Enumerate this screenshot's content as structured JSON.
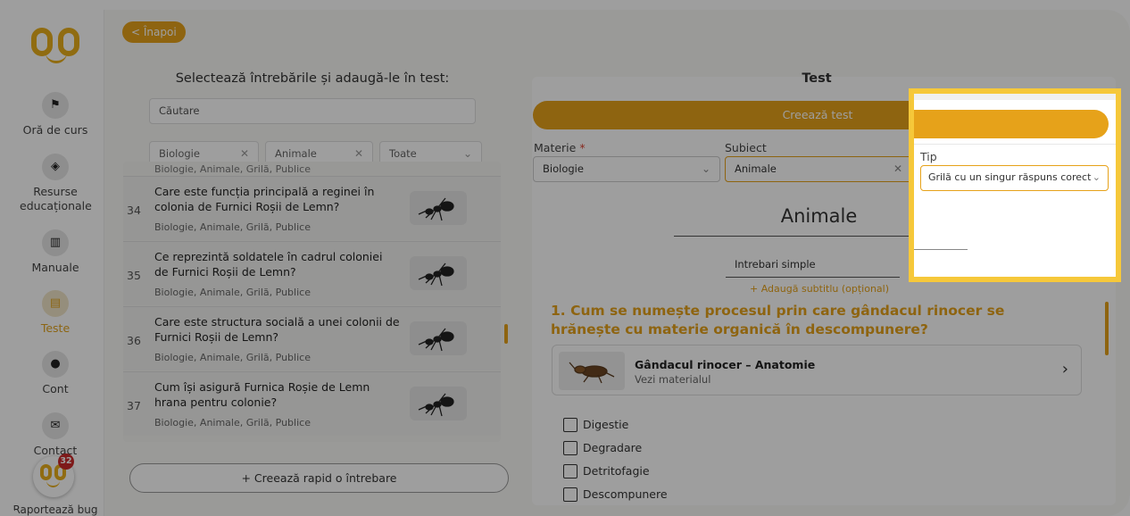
{
  "sidebar": {
    "items": [
      {
        "label": "Oră de curs",
        "icon": "presentation-icon",
        "glyph": "⚑"
      },
      {
        "label": "Resurse educaționale",
        "icon": "cube-icon",
        "glyph": "◈"
      },
      {
        "label": "Manuale",
        "icon": "book-icon",
        "glyph": "▥"
      },
      {
        "label": "Teste",
        "icon": "document-icon",
        "glyph": "▤"
      },
      {
        "label": "Cont",
        "icon": "user-icon",
        "glyph": "●"
      },
      {
        "label": "Contact",
        "icon": "mail-icon",
        "glyph": "✉"
      }
    ],
    "badge": "32",
    "bug_label": "Raportează bug"
  },
  "left": {
    "back_label": "< Înapoi",
    "title": "Selectează întrebările și adaugă-le în test:",
    "search_placeholder": "Căutare",
    "filters": [
      "Biologie",
      "Animale",
      "Toate"
    ],
    "partial_tags": "Biologie, Animale, Grilă, Publice",
    "questions": [
      {
        "num": "34",
        "text": "Care este funcția principală a reginei în colonia de Furnici Roșii de Lemn?",
        "tags": "Biologie, Animale, Grilă, Publice"
      },
      {
        "num": "35",
        "text": "Ce reprezintă soldatele în cadrul coloniei de Furnici Roșii de Lemn?",
        "tags": "Biologie, Animale, Grilă, Publice"
      },
      {
        "num": "36",
        "text": "Care este structura socială a unei colonii de Furnici Roșii de Lemn?",
        "tags": "Biologie, Animale, Grilă, Publice"
      },
      {
        "num": "37",
        "text": "Cum își asigură Furnica Roșie de Lemn hrana pentru colonie?",
        "tags": "Biologie, Animale, Grilă, Publice"
      }
    ],
    "quick_create": "+ Creează rapid o întrebare"
  },
  "right": {
    "title": "Test",
    "create_button": "Creează test",
    "materie_label": "Materie",
    "materie_value": "Biologie",
    "subiect_label": "Subiect",
    "subiect_value": "Animale",
    "tip_label": "Tip",
    "tip_value": "Grilă cu un singur răspuns corect",
    "subject_title": "Animale",
    "simple_questions": "Intrebari simple",
    "add_subtitle": "+ Adaugă subtitlu (opțional)",
    "question": "1. Cum se numește procesul prin care gândacul rinocer se hrănește cu materie organică în descompunere?",
    "material_title": "Gândacul rinocer – Anatomie",
    "material_sub": "Vezi materialul",
    "answers": [
      "Digestie",
      "Degradare",
      "Detritofagie",
      "Descompunere"
    ]
  },
  "colors": {
    "accent": "#e6a21a",
    "highlight": "#f6c83a",
    "badge": "#cc2b2b"
  }
}
